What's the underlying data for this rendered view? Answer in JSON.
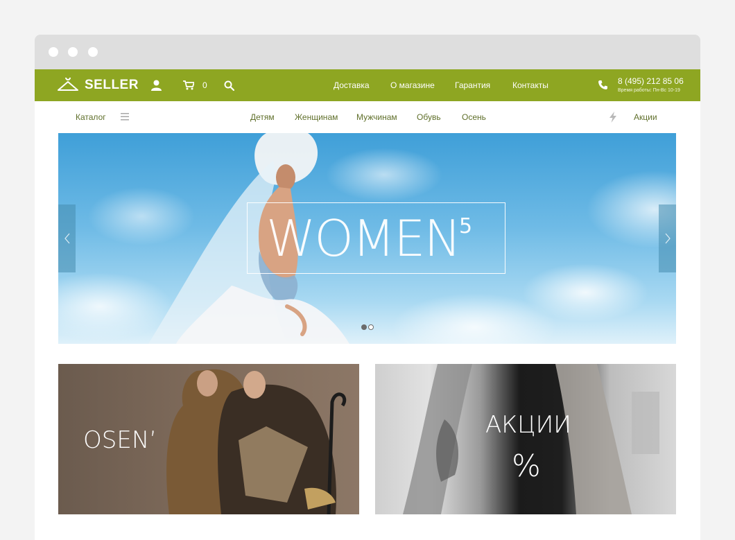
{
  "brand": {
    "name": "SELLER",
    "accent_color": "#8ea622"
  },
  "header": {
    "cart_count": "0",
    "nav": [
      "Доставка",
      "О магазине",
      "Гарантия",
      "Контакты"
    ],
    "phone": "8 (495) 212 85 06",
    "hours": "Время работы: Пн-Вс 10-19"
  },
  "catalog_bar": {
    "catalog_label": "Каталог",
    "categories": [
      "Детям",
      "Женщинам",
      "Мужчинам",
      "Обувь",
      "Осень"
    ],
    "sale_label": "Акции"
  },
  "hero": {
    "title": "WOMEN",
    "superscript": "5",
    "slide_count": 2,
    "active_slide": 1
  },
  "promos": [
    {
      "label": "OSEN’"
    },
    {
      "label": "АКЦИИ",
      "sublabel": "%"
    }
  ],
  "icons": [
    "hanger-icon",
    "user-icon",
    "cart-icon",
    "search-icon",
    "phone-icon",
    "hamburger-icon",
    "lightning-icon",
    "chevron-left-icon",
    "chevron-right-icon"
  ]
}
